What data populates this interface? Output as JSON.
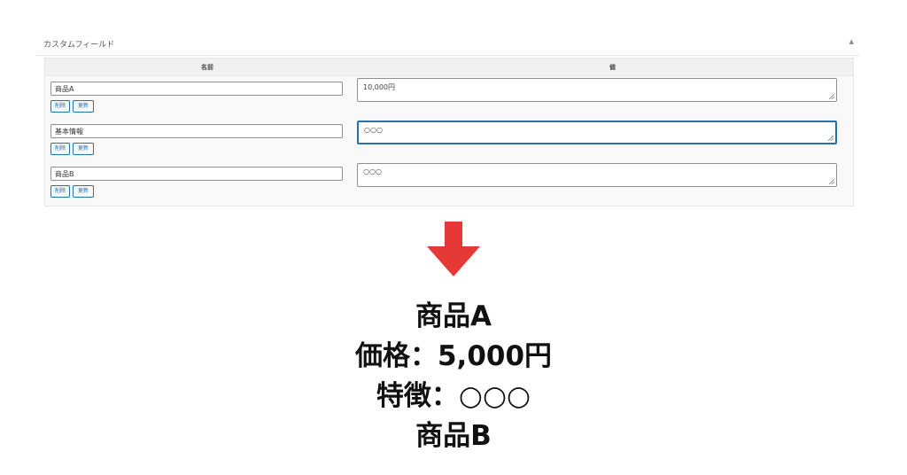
{
  "panel": {
    "title": "カスタムフィールド",
    "toggle_icon": "▲"
  },
  "table": {
    "header_name": "名前",
    "header_value": "値",
    "rows": [
      {
        "key": "商品A",
        "value": "10,000円",
        "delete_label": "削除",
        "update_label": "更新"
      },
      {
        "key": "基本情報",
        "value": "○○○",
        "delete_label": "削除",
        "update_label": "更新"
      },
      {
        "key": "商品B",
        "value": "○○○",
        "delete_label": "削除",
        "update_label": "更新"
      }
    ]
  },
  "arrow_color": "#e53935",
  "result": {
    "line1": "商品A",
    "line2": "価格：5,000円",
    "line3": "特徴：○○○",
    "line4": "商品B"
  }
}
